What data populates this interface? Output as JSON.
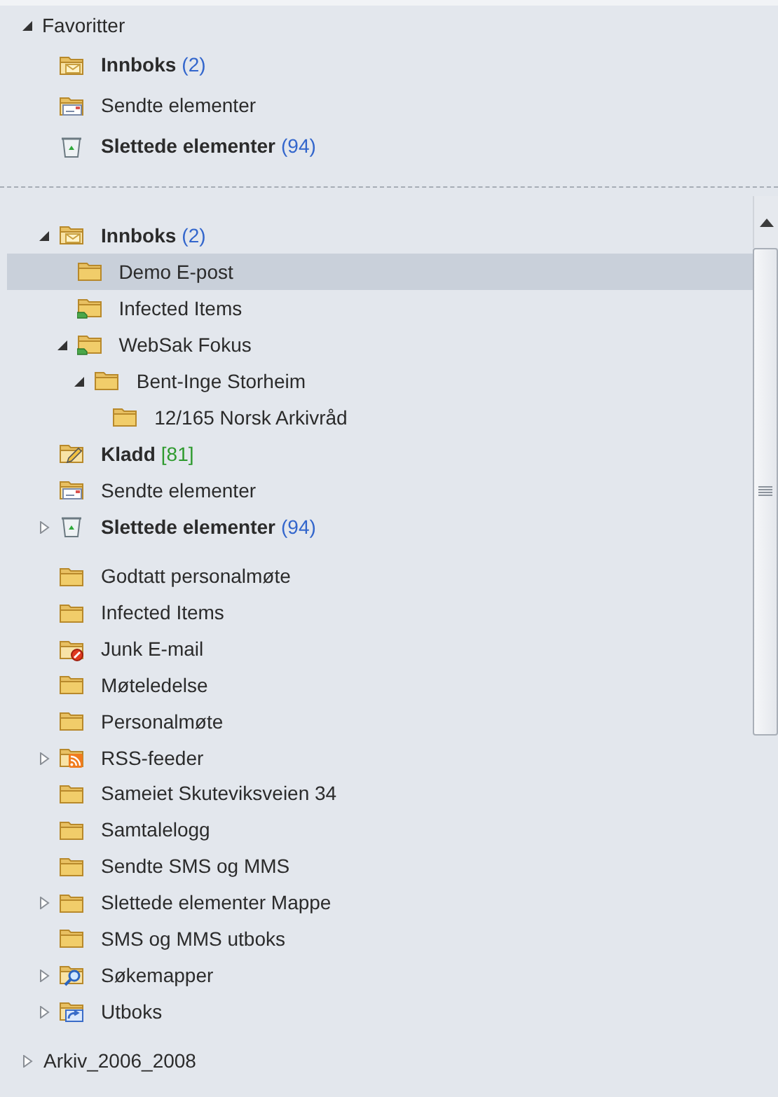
{
  "favorites": {
    "title": "Favoritter",
    "expanded": true,
    "items": [
      {
        "label": "Innboks",
        "kind": "inbox",
        "bold": true,
        "count": "(2)",
        "color": "#3366cc"
      },
      {
        "label": "Sendte elementer",
        "kind": "sent",
        "bold": false
      },
      {
        "label": "Slettede elementer",
        "kind": "trash",
        "bold": true,
        "count": "(94)",
        "color": "#3366cc"
      }
    ]
  },
  "mailbox": {
    "special_folders": [
      {
        "label": "Innboks",
        "kind": "inbox",
        "bold": true,
        "count": "(2)",
        "color": "#3366cc",
        "expanded": true,
        "selected": false,
        "children": [
          {
            "label": "Demo E-post",
            "kind": "folder",
            "bold": false,
            "selected": true
          },
          {
            "label": "Infected Items",
            "kind": "shared",
            "bold": false,
            "selected": false
          },
          {
            "label": "WebSak Fokus",
            "kind": "shared",
            "bold": false,
            "expanded": true,
            "selected": false,
            "children": [
              {
                "label": "Bent-Inge Storheim",
                "kind": "folder",
                "bold": false,
                "expanded": true,
                "selected": false,
                "children": [
                  {
                    "label": "12/165 Norsk Arkivråd",
                    "kind": "folder",
                    "bold": false,
                    "selected": false
                  }
                ]
              }
            ]
          }
        ]
      },
      {
        "label": "Kladd",
        "kind": "draft",
        "bold": true,
        "count": "[81]",
        "color": "#2e9a2e",
        "selected": false
      },
      {
        "label": "Sendte elementer",
        "kind": "sent",
        "bold": false,
        "selected": false
      },
      {
        "label": "Slettede elementer",
        "kind": "trash",
        "bold": true,
        "count": "(94)",
        "color": "#3366cc",
        "expanded": false,
        "selected": false
      }
    ],
    "folders": [
      {
        "label": "Godtatt personalmøte",
        "kind": "folder",
        "bold": false,
        "selected": false
      },
      {
        "label": "Infected Items",
        "kind": "folder",
        "bold": false,
        "selected": false
      },
      {
        "label": "Junk E-mail",
        "kind": "junk",
        "bold": false,
        "selected": false
      },
      {
        "label": "Møteledelse",
        "kind": "folder",
        "bold": false,
        "selected": false
      },
      {
        "label": "Personalmøte",
        "kind": "folder",
        "bold": false,
        "selected": false
      },
      {
        "label": "RSS-feeder",
        "kind": "rss",
        "bold": false,
        "expanded": false,
        "selected": false
      },
      {
        "label": "Sameiet Skuteviksveien 34",
        "kind": "folder",
        "bold": false,
        "selected": false
      },
      {
        "label": "Samtalelogg",
        "kind": "folder",
        "bold": false,
        "selected": false
      },
      {
        "label": "Sendte SMS og MMS",
        "kind": "folder",
        "bold": false,
        "selected": false
      },
      {
        "label": "Slettede elementer Mappe",
        "kind": "folder",
        "bold": false,
        "expanded": false,
        "selected": false
      },
      {
        "label": "SMS og MMS utboks",
        "kind": "folder",
        "bold": false,
        "selected": false
      },
      {
        "label": "Søkemapper",
        "kind": "search",
        "bold": false,
        "expanded": false,
        "selected": false
      },
      {
        "label": "Utboks",
        "kind": "outbox",
        "bold": false,
        "expanded": false,
        "selected": false
      }
    ]
  },
  "archives": [
    {
      "label": "Arkiv_2006_2008",
      "expanded": false
    }
  ]
}
